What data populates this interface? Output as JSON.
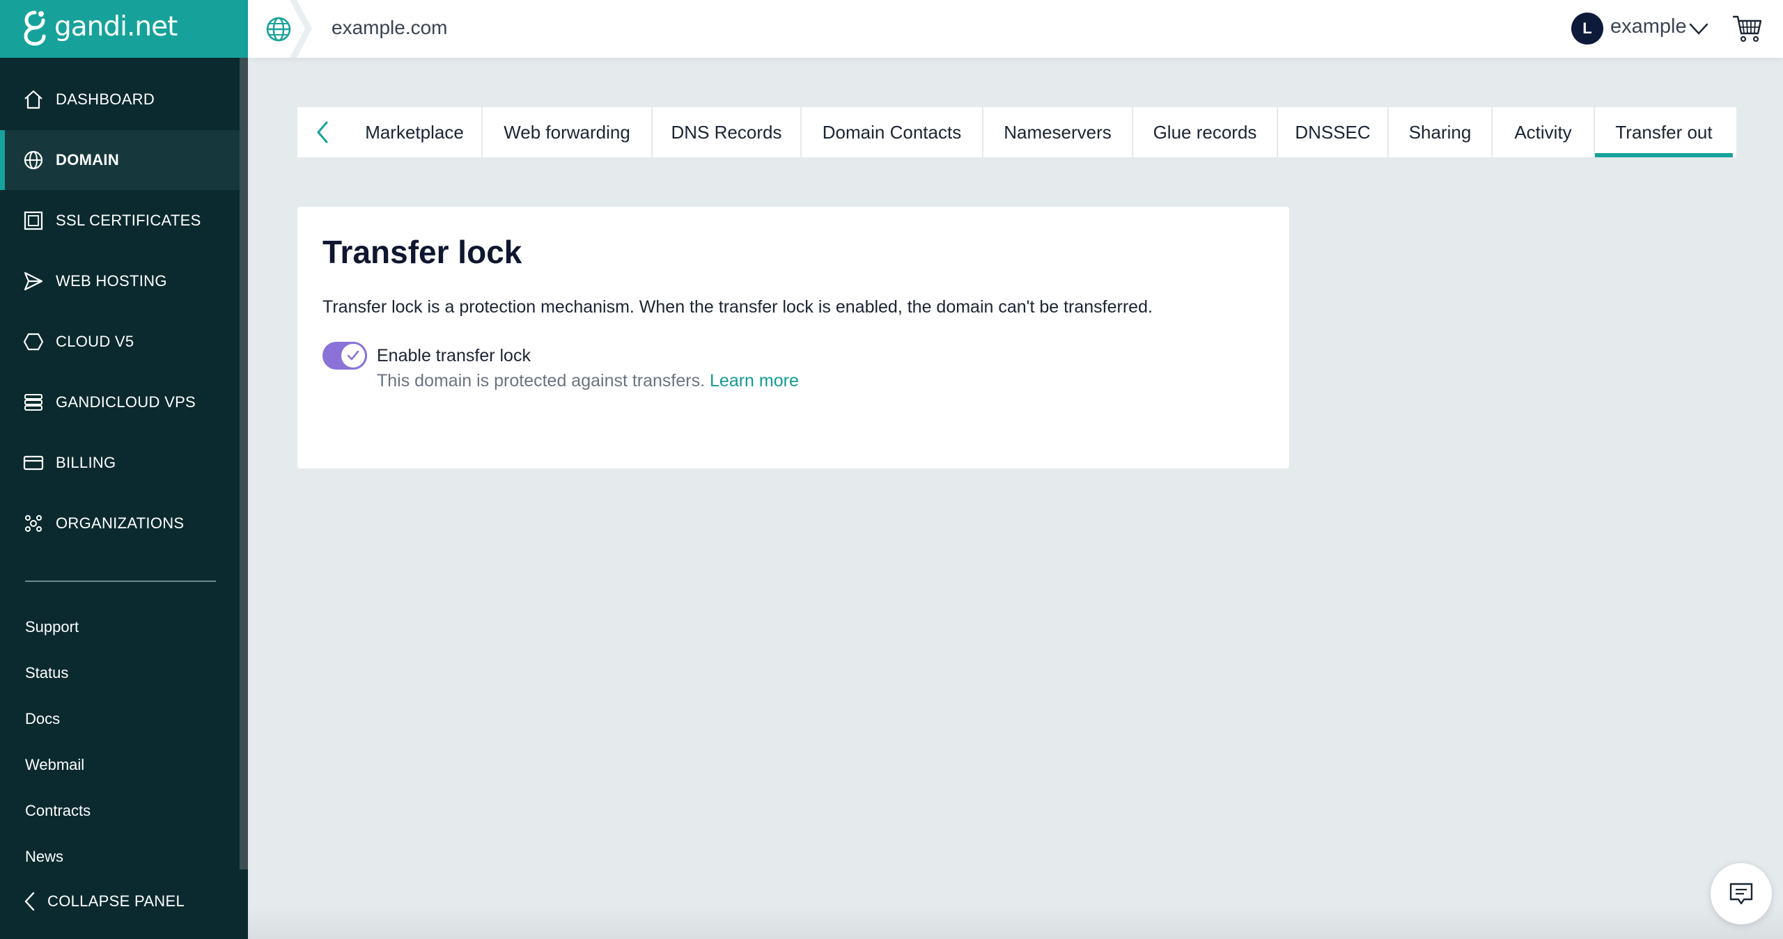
{
  "brand": {
    "name": "gandi.net",
    "accent": "#16a29a",
    "sidebar_bg": "#0b2a2f"
  },
  "topbar": {
    "domain": "example.com",
    "avatar_initial": "L",
    "username": "example",
    "icons": [
      "globe-icon",
      "chevron-down-icon",
      "cart-icon"
    ]
  },
  "sidebar": {
    "items": [
      {
        "label": "DASHBOARD",
        "icon": "home-icon",
        "active": false
      },
      {
        "label": "DOMAIN",
        "icon": "globe-icon",
        "active": true
      },
      {
        "label": "SSL CERTIFICATES",
        "icon": "certificate-icon",
        "active": false
      },
      {
        "label": "WEB HOSTING",
        "icon": "send-icon",
        "active": false
      },
      {
        "label": "CLOUD V5",
        "icon": "hexagon-icon",
        "active": false
      },
      {
        "label": "GANDICLOUD VPS",
        "icon": "server-icon",
        "active": false
      },
      {
        "label": "BILLING",
        "icon": "credit-card-icon",
        "active": false
      },
      {
        "label": "ORGANIZATIONS",
        "icon": "organization-icon",
        "active": false
      }
    ],
    "links": [
      "Support",
      "Status",
      "Docs",
      "Webmail",
      "Contracts",
      "News"
    ],
    "collapse_label": "COLLAPSE PANEL"
  },
  "tabs": [
    {
      "label": "Marketplace",
      "active": false
    },
    {
      "label": "Web forwarding",
      "active": false
    },
    {
      "label": "DNS Records",
      "active": false
    },
    {
      "label": "Domain Contacts",
      "active": false
    },
    {
      "label": "Nameservers",
      "active": false
    },
    {
      "label": "Glue records",
      "active": false
    },
    {
      "label": "DNSSEC",
      "active": false
    },
    {
      "label": "Sharing",
      "active": false
    },
    {
      "label": "Activity",
      "active": false
    },
    {
      "label": "Transfer out",
      "active": true
    }
  ],
  "transfer_lock": {
    "title": "Transfer lock",
    "description": "Transfer lock is a protection mechanism. When the transfer lock is enabled, the domain can't be transferred.",
    "toggle_label": "Enable transfer lock",
    "toggle_enabled": true,
    "help_text": "This domain is protected against transfers.",
    "learn_more": "Learn more",
    "toggle_color": "#8a72d8"
  },
  "chat": {
    "icon": "chat-icon"
  }
}
